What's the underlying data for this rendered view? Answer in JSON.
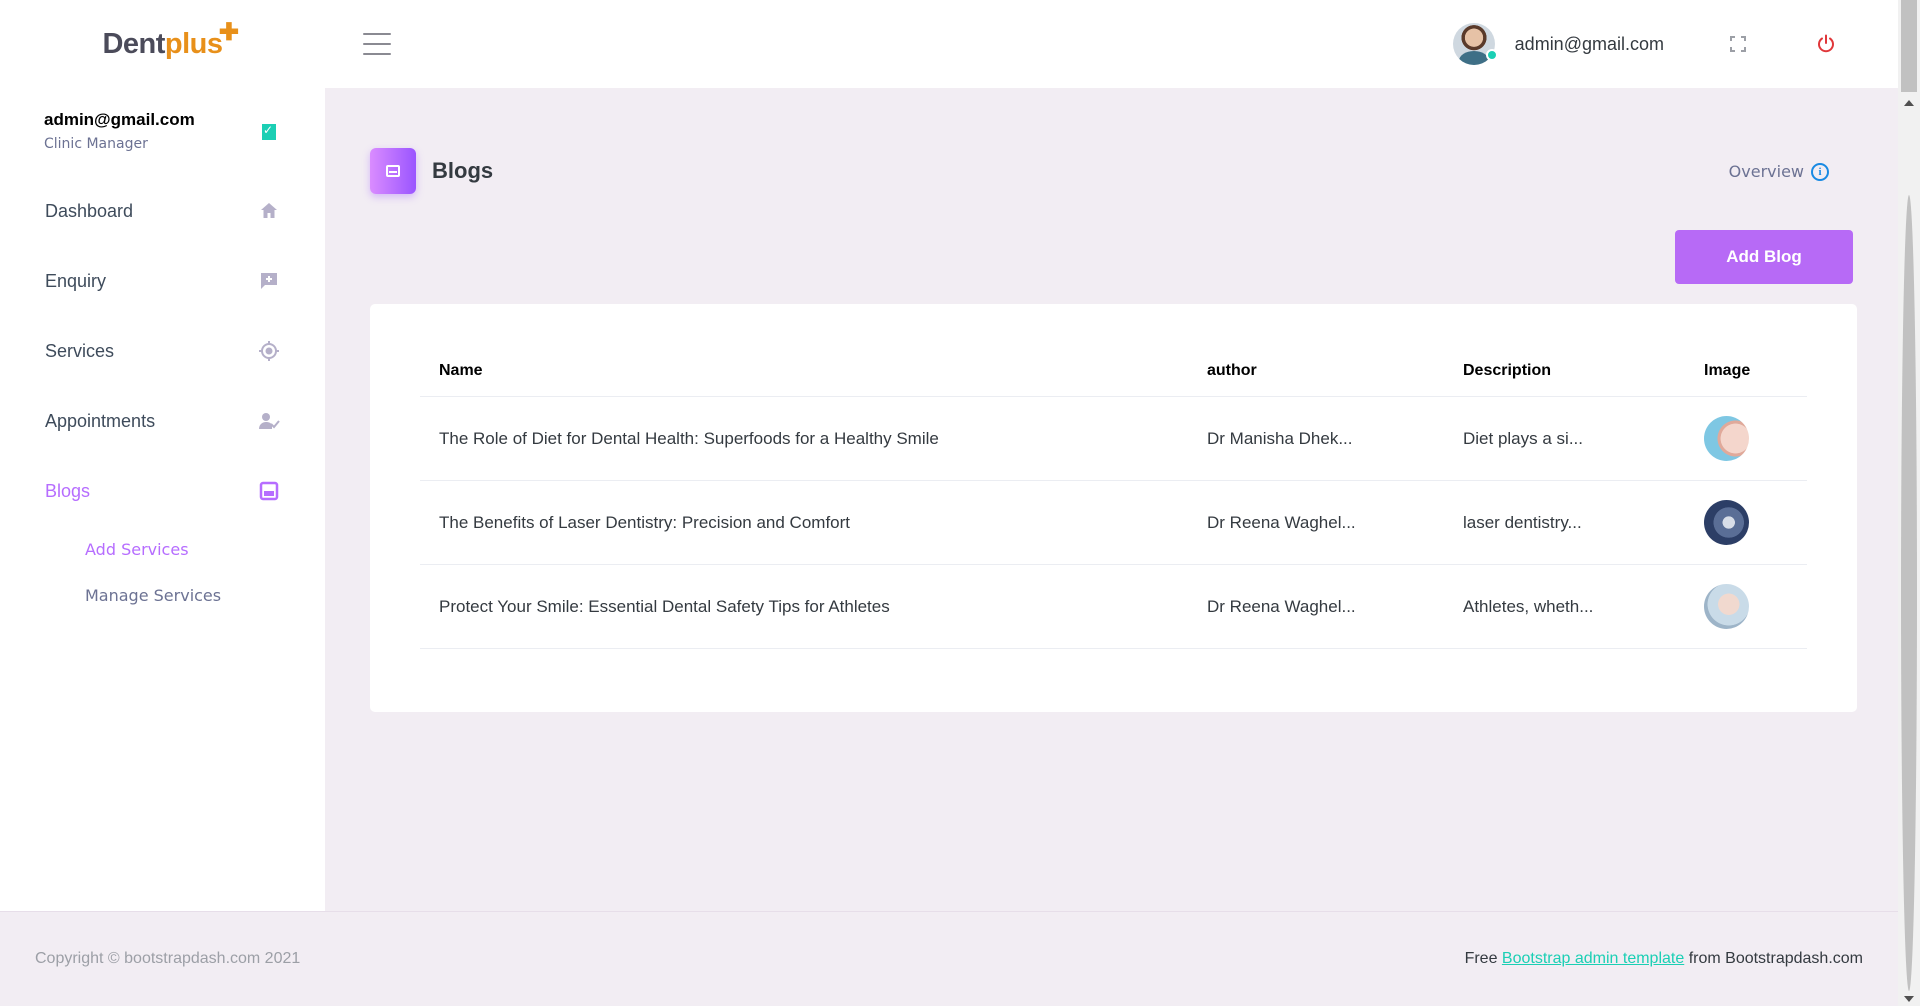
{
  "brand": {
    "name_part1": "Dent",
    "name_part2": "plus",
    "mark": "✚"
  },
  "navbar": {
    "user_email": "admin@gmail.com",
    "menu_icon": "hamburger-icon",
    "fullscreen_icon": "fullscreen-icon",
    "power_icon": "power-icon",
    "colors": {
      "power": "#e0373a",
      "online": "#1bcfb4"
    }
  },
  "sidebar": {
    "profile": {
      "name": "admin@gmail.com",
      "role": "Clinic Manager",
      "badge_icon": "bookmark-check-icon"
    },
    "items": [
      {
        "label": "Dashboard",
        "icon": "home-icon"
      },
      {
        "label": "Enquiry",
        "icon": "message-plus-icon"
      },
      {
        "label": "Services",
        "icon": "crosshairs-icon"
      },
      {
        "label": "Appointments",
        "icon": "account-check-icon"
      },
      {
        "label": "Blogs",
        "icon": "blog-icon",
        "active": true
      }
    ],
    "submenu": [
      {
        "label": "Add Services",
        "active": true
      },
      {
        "label": "Manage Services"
      }
    ]
  },
  "page": {
    "title": "Blogs",
    "overview_label": "Overview",
    "add_button_label": "Add Blog",
    "accent": "#b66dff"
  },
  "table": {
    "headers": [
      "Name",
      "author",
      "Description",
      "Image"
    ],
    "rows": [
      {
        "name": "The Role of Diet for Dental Health: Superfoods for a Healthy Smile",
        "author": "Dr Manisha Dhek...",
        "description": "Diet plays a si...",
        "image": "dental-smile-thumbnail"
      },
      {
        "name": "The Benefits of Laser Dentistry: Precision and Comfort",
        "author": "Dr Reena Waghel...",
        "description": "laser dentistry...",
        "image": "dentist-procedure-thumbnail"
      },
      {
        "name": "Protect Your Smile: Essential Dental Safety Tips for Athletes",
        "author": "Dr Reena Waghel...",
        "description": "Athletes, wheth...",
        "image": "dental-check-thumbnail"
      }
    ]
  },
  "footer": {
    "copyright": "Copyright © bootstrapdash.com 2021",
    "credit_prefix": "Free ",
    "credit_link": "Bootstrap admin template",
    "credit_suffix": " from Bootstrapdash.com"
  }
}
